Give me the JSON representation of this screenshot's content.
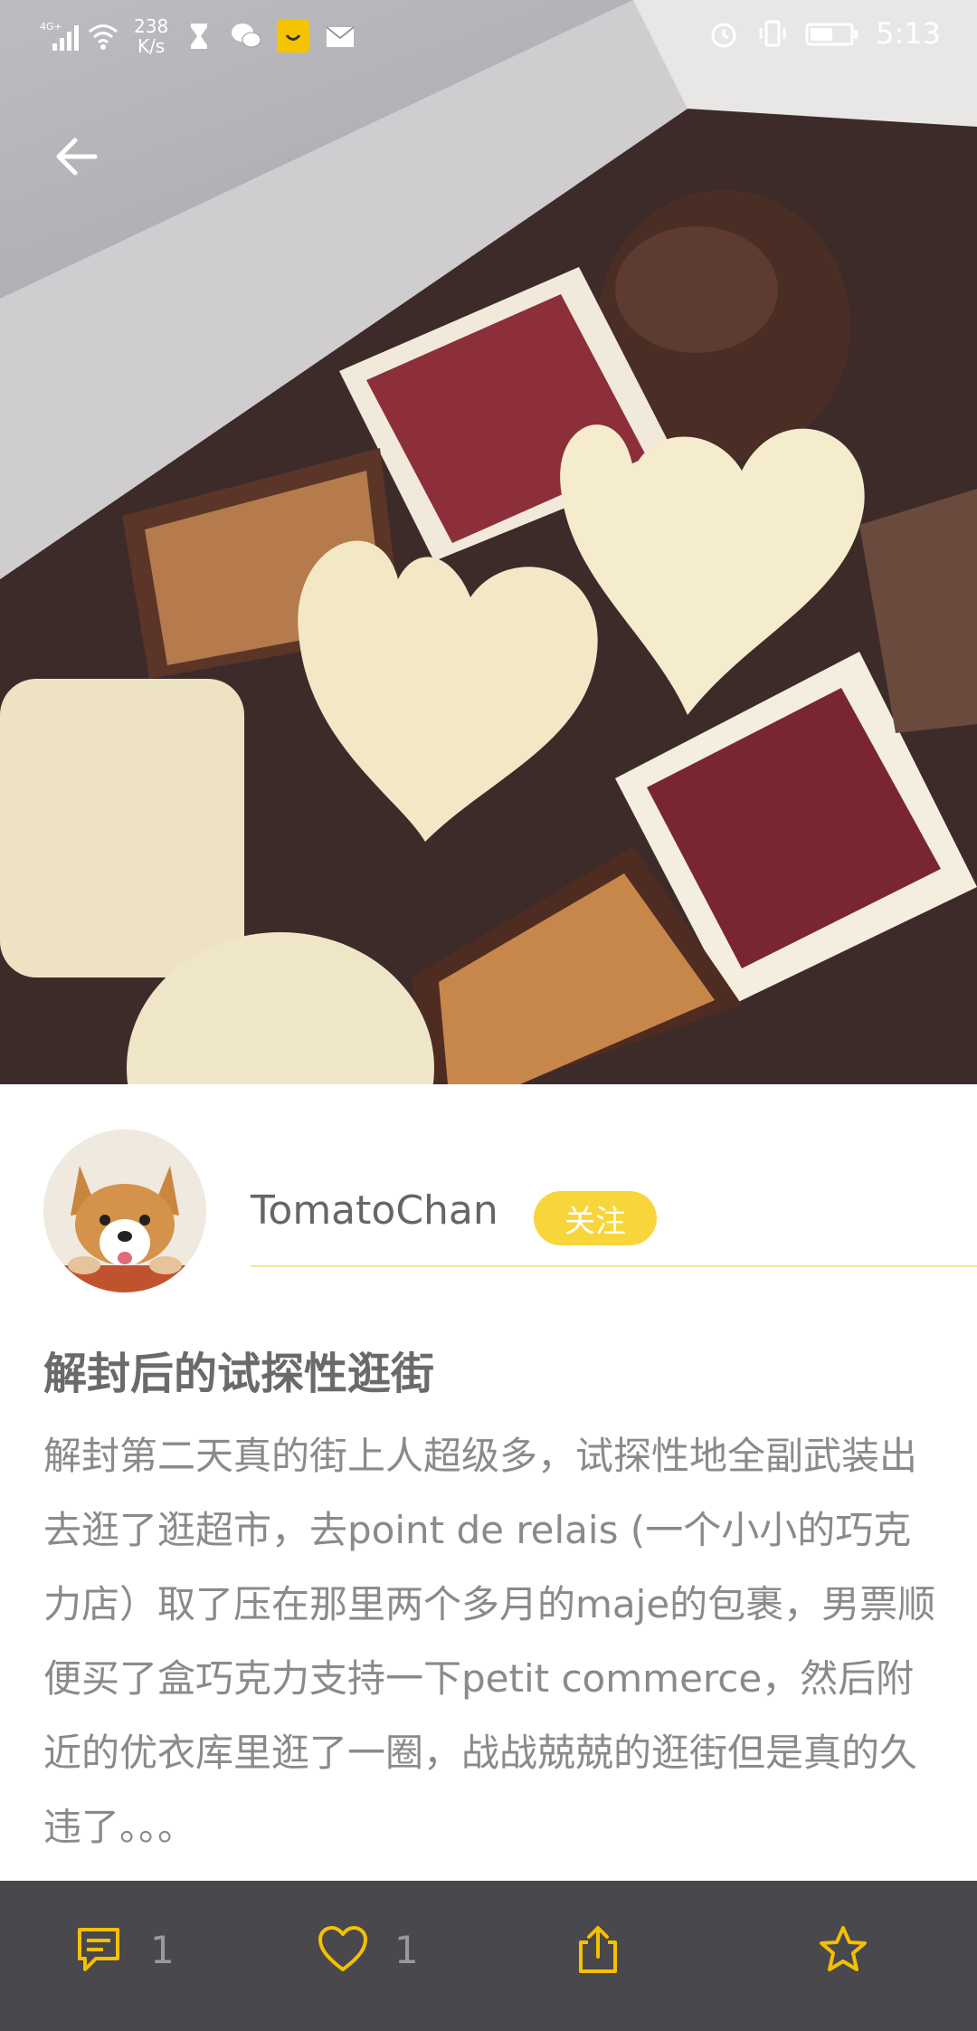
{
  "status_bar": {
    "network": "4G+",
    "speed_value": "238",
    "speed_unit": "K/s",
    "time": "5:13"
  },
  "hero": {
    "image_alt": "chocolates in box"
  },
  "author": {
    "username": "TomatoChan",
    "follow_label": "关注"
  },
  "post": {
    "title": "解封后的试探性逛街",
    "body": "解封第二天真的街上人超级多，试探性地全副武装出去逛了逛超市，去point de relais (一个小小的巧克力店）取了压在那里两个多月的maje的包裹，男票顺便买了盒巧克力支持一下petit commerce，然后附近的优衣库里逛了一圈，战战兢兢的逛街但是真的久违了。。。"
  },
  "bottom_bar": {
    "comment_count": "1",
    "like_count": "1"
  },
  "colors": {
    "accent": "#f8d53a",
    "icon_yellow": "#f4c000",
    "bottom_bar_bg": "#48484d"
  }
}
